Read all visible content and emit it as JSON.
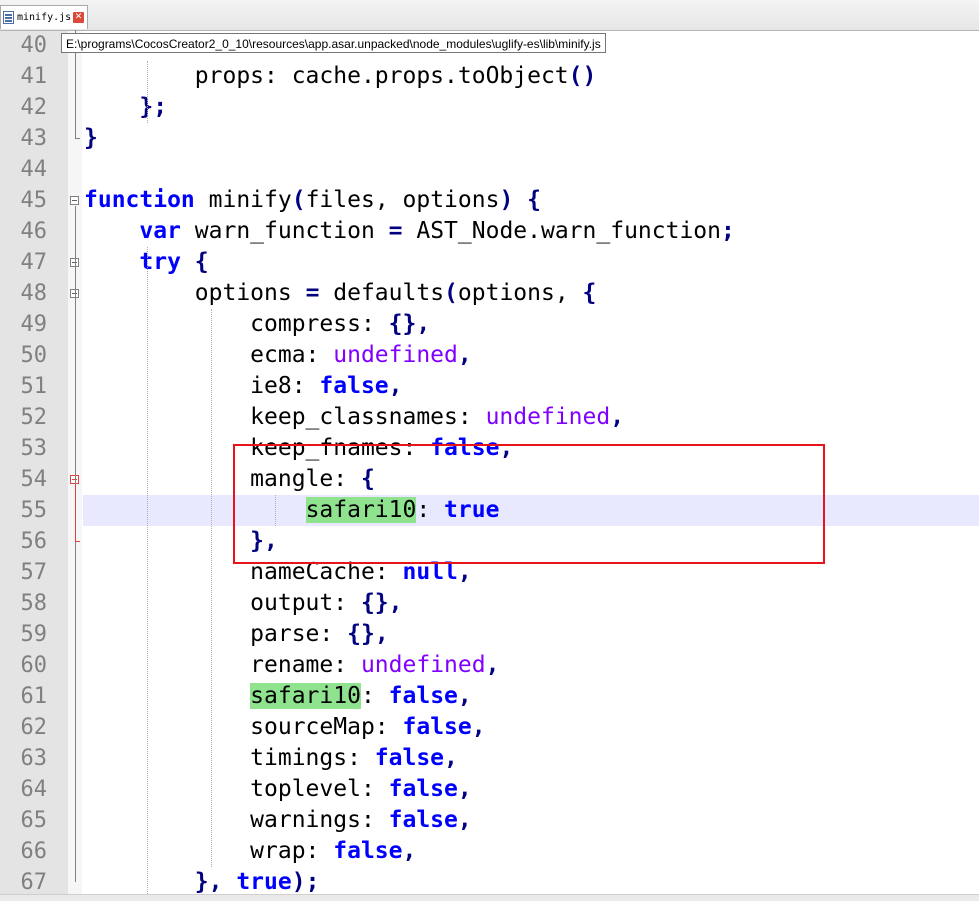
{
  "tabs": [
    {
      "label": "minify.js",
      "icon": "file-icon",
      "close_icon": "close-icon",
      "close_glyph": "✕"
    }
  ],
  "tooltip": {
    "text": "E:\\programs\\CocosCreator2_0_10\\resources\\app.asar.unpacked\\node_modules\\uglify-es\\lib\\minify.js"
  },
  "colors": {
    "keyword": "#0000ff",
    "undefined_literal": "#8000ff",
    "highlight": "#8fe38f",
    "current_line": "#e8e8ff",
    "annotation_box": "#e8141c"
  },
  "editor": {
    "current_line_number": "55",
    "lines": [
      {
        "num": "40",
        "segments": []
      },
      {
        "num": "41",
        "segments": [
          {
            "t": "        props: cache.props.toObject",
            "c": ""
          },
          {
            "t": "()",
            "c": "op"
          }
        ]
      },
      {
        "num": "42",
        "segments": [
          {
            "t": "    }",
            "c": "op"
          },
          {
            "t": ";",
            "c": "op"
          }
        ]
      },
      {
        "num": "43",
        "segments": [
          {
            "t": "}",
            "c": "op"
          }
        ]
      },
      {
        "num": "44",
        "segments": []
      },
      {
        "num": "45",
        "segments": [
          {
            "t": "function",
            "c": "kw"
          },
          {
            "t": " minify",
            "c": ""
          },
          {
            "t": "(",
            "c": "op"
          },
          {
            "t": "files, options",
            "c": ""
          },
          {
            "t": ")",
            "c": "op"
          },
          {
            "t": " ",
            "c": ""
          },
          {
            "t": "{",
            "c": "op"
          }
        ]
      },
      {
        "num": "46",
        "segments": [
          {
            "t": "    ",
            "c": ""
          },
          {
            "t": "var",
            "c": "kw"
          },
          {
            "t": " warn_function ",
            "c": ""
          },
          {
            "t": "=",
            "c": "op"
          },
          {
            "t": " AST_Node.warn_function",
            "c": ""
          },
          {
            "t": ";",
            "c": "op"
          }
        ]
      },
      {
        "num": "47",
        "segments": [
          {
            "t": "    ",
            "c": ""
          },
          {
            "t": "try",
            "c": "kw"
          },
          {
            "t": " ",
            "c": ""
          },
          {
            "t": "{",
            "c": "op"
          }
        ]
      },
      {
        "num": "48",
        "segments": [
          {
            "t": "        options ",
            "c": ""
          },
          {
            "t": "=",
            "c": "op"
          },
          {
            "t": " defaults",
            "c": ""
          },
          {
            "t": "(",
            "c": "op"
          },
          {
            "t": "options, ",
            "c": ""
          },
          {
            "t": "{",
            "c": "op"
          }
        ]
      },
      {
        "num": "49",
        "segments": [
          {
            "t": "            compress: ",
            "c": ""
          },
          {
            "t": "{}",
            "c": "op"
          },
          {
            "t": ",",
            "c": "op"
          }
        ]
      },
      {
        "num": "50",
        "segments": [
          {
            "t": "            ecma: ",
            "c": ""
          },
          {
            "t": "undefined",
            "c": "undef"
          },
          {
            "t": ",",
            "c": "op"
          }
        ]
      },
      {
        "num": "51",
        "segments": [
          {
            "t": "            ie8: ",
            "c": ""
          },
          {
            "t": "false",
            "c": "lit"
          },
          {
            "t": ",",
            "c": "op"
          }
        ]
      },
      {
        "num": "52",
        "segments": [
          {
            "t": "            keep_classnames: ",
            "c": ""
          },
          {
            "t": "undefined",
            "c": "undef"
          },
          {
            "t": ",",
            "c": "op"
          }
        ]
      },
      {
        "num": "53",
        "segments": [
          {
            "t": "            keep_fnames: ",
            "c": ""
          },
          {
            "t": "false",
            "c": "lit"
          },
          {
            "t": ",",
            "c": "op"
          }
        ]
      },
      {
        "num": "54",
        "segments": [
          {
            "t": "            mangle: ",
            "c": ""
          },
          {
            "t": "{",
            "c": "op"
          }
        ]
      },
      {
        "num": "55",
        "segments": [
          {
            "t": "                ",
            "c": ""
          },
          {
            "t": "safari10",
            "c": "hl"
          },
          {
            "t": ": ",
            "c": ""
          },
          {
            "t": "true",
            "c": "lit"
          }
        ]
      },
      {
        "num": "56",
        "segments": [
          {
            "t": "            }",
            "c": "op"
          },
          {
            "t": ",",
            "c": "op"
          }
        ]
      },
      {
        "num": "57",
        "segments": [
          {
            "t": "            nameCache: ",
            "c": ""
          },
          {
            "t": "null",
            "c": "lit"
          },
          {
            "t": ",",
            "c": "op"
          }
        ]
      },
      {
        "num": "58",
        "segments": [
          {
            "t": "            output: ",
            "c": ""
          },
          {
            "t": "{}",
            "c": "op"
          },
          {
            "t": ",",
            "c": "op"
          }
        ]
      },
      {
        "num": "59",
        "segments": [
          {
            "t": "            parse: ",
            "c": ""
          },
          {
            "t": "{}",
            "c": "op"
          },
          {
            "t": ",",
            "c": "op"
          }
        ]
      },
      {
        "num": "60",
        "segments": [
          {
            "t": "            rename: ",
            "c": ""
          },
          {
            "t": "undefined",
            "c": "undef"
          },
          {
            "t": ",",
            "c": "op"
          }
        ]
      },
      {
        "num": "61",
        "segments": [
          {
            "t": "            ",
            "c": ""
          },
          {
            "t": "safari10",
            "c": "hl"
          },
          {
            "t": ": ",
            "c": ""
          },
          {
            "t": "false",
            "c": "lit"
          },
          {
            "t": ",",
            "c": "op"
          }
        ]
      },
      {
        "num": "62",
        "segments": [
          {
            "t": "            sourceMap: ",
            "c": ""
          },
          {
            "t": "false",
            "c": "lit"
          },
          {
            "t": ",",
            "c": "op"
          }
        ]
      },
      {
        "num": "63",
        "segments": [
          {
            "t": "            timings: ",
            "c": ""
          },
          {
            "t": "false",
            "c": "lit"
          },
          {
            "t": ",",
            "c": "op"
          }
        ]
      },
      {
        "num": "64",
        "segments": [
          {
            "t": "            toplevel: ",
            "c": ""
          },
          {
            "t": "false",
            "c": "lit"
          },
          {
            "t": ",",
            "c": "op"
          }
        ]
      },
      {
        "num": "65",
        "segments": [
          {
            "t": "            warnings: ",
            "c": ""
          },
          {
            "t": "false",
            "c": "lit"
          },
          {
            "t": ",",
            "c": "op"
          }
        ]
      },
      {
        "num": "66",
        "segments": [
          {
            "t": "            wrap: ",
            "c": ""
          },
          {
            "t": "false",
            "c": "lit"
          },
          {
            "t": ",",
            "c": "op"
          }
        ]
      },
      {
        "num": "67",
        "segments": [
          {
            "t": "        }",
            "c": "op"
          },
          {
            "t": ", ",
            "c": "op"
          },
          {
            "t": "true",
            "c": "lit"
          },
          {
            "t": ")",
            "c": "op"
          },
          {
            "t": ";",
            "c": "op"
          }
        ]
      }
    ]
  }
}
